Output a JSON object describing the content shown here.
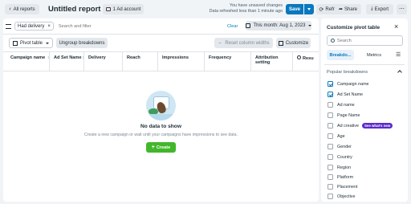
{
  "topbar": {
    "back_label": "All reports",
    "title": "Untitled report",
    "ad_account_label": "1 Ad account",
    "unsaved_line1": "You have unsaved changes",
    "unsaved_line2": "Data refreshed less than 1 minute ago",
    "save_label": "Save",
    "refresh_label": "Refresh",
    "share_label": "Share",
    "export_label": "Export"
  },
  "filterbar": {
    "chip_label": "Had delivery",
    "search_placeholder": "Search and filter",
    "clear_label": "Clear",
    "date_label": "This month: Aug 1, 2023"
  },
  "toolbar": {
    "pivot_label": "Pivot table",
    "ungroup_label": "Ungroup breakdowns",
    "reset_widths_label": "Reset column widths",
    "customize_label": "Customize"
  },
  "table": {
    "columns": [
      "Campaign name",
      "Ad Set Name",
      "Delivery",
      "Reach",
      "Impressions",
      "Frequency",
      "Attribution setting",
      "Resu"
    ]
  },
  "empty_state": {
    "title": "No data to show",
    "subtitle": "Create a new campaign or wait until your campaigns have impressions to see data.",
    "create_label": "Create"
  },
  "side_panel": {
    "title": "Customize pivot table",
    "search_placeholder": "Search",
    "tabs": [
      "Breakdo...",
      "Metrics"
    ],
    "section_title": "Popular breakdowns",
    "items": [
      {
        "label": "Campaign name",
        "checked": true
      },
      {
        "label": "Ad Set Name",
        "checked": true
      },
      {
        "label": "Ad name",
        "checked": false
      },
      {
        "label": "Page Name",
        "checked": false
      },
      {
        "label": "Ad creative",
        "checked": false,
        "badge": "See what's new"
      },
      {
        "label": "Age",
        "checked": false
      },
      {
        "label": "Gender",
        "checked": false
      },
      {
        "label": "Country",
        "checked": false
      },
      {
        "label": "Region",
        "checked": false
      },
      {
        "label": "Platform",
        "checked": false
      },
      {
        "label": "Placement",
        "checked": false
      },
      {
        "label": "Objective",
        "checked": false
      }
    ]
  },
  "colors": {
    "accent": "#0a78be",
    "create_green": "#42b72a",
    "badge_purple": "#5b2bc9"
  }
}
